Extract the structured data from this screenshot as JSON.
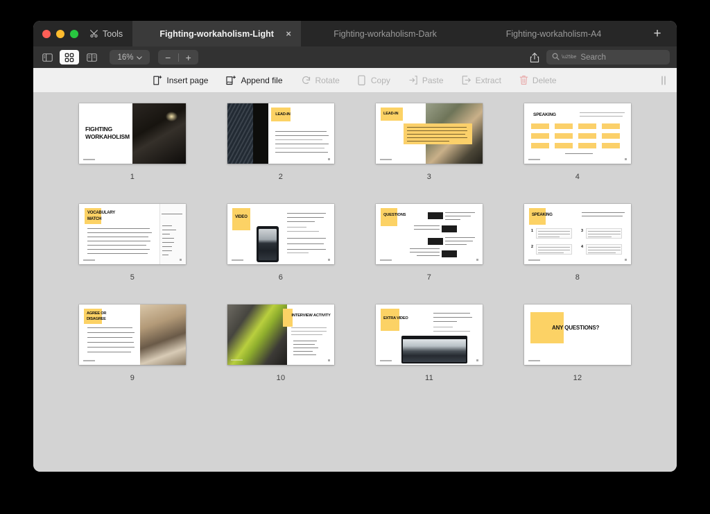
{
  "window": {
    "traffic_lights": [
      "close",
      "minimize",
      "maximize"
    ],
    "tools_label": "Tools"
  },
  "tabs": [
    {
      "label": "Fighting-workaholism-Light",
      "active": true,
      "close": "×"
    },
    {
      "label": "Fighting-workaholism-Dark",
      "active": false,
      "close": "×"
    },
    {
      "label": "Fighting-workaholism-A4",
      "active": false,
      "close": "×"
    }
  ],
  "new_tab_label": "+",
  "toolbar": {
    "sidebar_icon": "sidebar-icon",
    "grid_icon": "thumbnail-grid-icon",
    "split_icon": "split-view-icon",
    "zoom_value": "16%",
    "zoom_caret": "⌄",
    "zoom_out": "−",
    "zoom_in": "+",
    "share_icon": "share-icon",
    "search_placeholder": "Search",
    "search_value": ""
  },
  "actions": [
    {
      "label": "Insert page",
      "icon": "insert-page-icon",
      "enabled": true
    },
    {
      "label": "Append file",
      "icon": "append-file-icon",
      "enabled": true
    },
    {
      "label": "Rotate",
      "icon": "rotate-icon",
      "enabled": false
    },
    {
      "label": "Copy",
      "icon": "copy-icon",
      "enabled": false
    },
    {
      "label": "Paste",
      "icon": "paste-icon",
      "enabled": false
    },
    {
      "label": "Extract",
      "icon": "extract-icon",
      "enabled": false
    },
    {
      "label": "Delete",
      "icon": "trash-icon",
      "enabled": false
    }
  ],
  "colors": {
    "accent_yellow": "#fbd06a",
    "titlebar": "#272727",
    "toolbar": "#323232",
    "actionbar": "#f0f0f0",
    "canvas": "#d3d3d3"
  },
  "pages": [
    {
      "number": "1",
      "title": "FIGHTING WORKAHOLISM",
      "layout": "title-photo-right"
    },
    {
      "number": "2",
      "title": "LEAD-IN",
      "layout": "photo-left-list-right"
    },
    {
      "number": "3",
      "title": "LEAD-IN",
      "layout": "quote-over-photo"
    },
    {
      "number": "4",
      "title": "SPEAKING",
      "layout": "word-grid"
    },
    {
      "number": "5",
      "title": "VOCABULARY MATCH",
      "layout": "two-column-match"
    },
    {
      "number": "6",
      "title": "VIDEO",
      "layout": "phone-video"
    },
    {
      "number": "7",
      "title": "QUESTIONS",
      "layout": "zigzag-questions"
    },
    {
      "number": "8",
      "title": "SPEAKING",
      "layout": "four-quote-cards"
    },
    {
      "number": "9",
      "title": "AGREE OR DISAGREE",
      "layout": "list-photo-right"
    },
    {
      "number": "10",
      "title": "INTERVIEW ACTIVITY",
      "layout": "photo-left-text-right"
    },
    {
      "number": "11",
      "title": "EXTRA VIDEO",
      "layout": "laptop-video"
    },
    {
      "number": "12",
      "title": "ANY QUESTIONS?",
      "layout": "closing"
    }
  ],
  "slide_text": {
    "p1_heading_line1": "FIGHTING",
    "p1_heading_line2": "WORKAHOLISM",
    "p3_quote": "“If we love our work, that doesn’t mean we’re addicted to it. But if we’re a workaholic, it’s easy to convince ourselves that we work so much because we love it or because we need to when we actually don’t.”",
    "p4_instruction": "Choose the most important factor for living a meaningful, fulfilled life, and explain your choice.",
    "p4_question": "What makes a life worthwhile?",
    "p4_words": [
      "Wealth",
      "Personal growth",
      "Leisure time",
      "Family",
      "Community service",
      "Mentoring",
      "Purpose",
      "Career success",
      "Health",
      "Spirituality",
      "Adventure",
      "Work-life balance"
    ],
    "p5_instruction": "Match the words and definitions.",
    "p5_words": [
      "obtrusive",
      "overstimulation",
      "recoil",
      "addiction",
      "objectivity",
      "antidote",
      "implicit",
      "insult"
    ],
    "p6_video_title": "Fighting Workaholism: You’re More Than a Success Machine",
    "p6_duration": "Duration: 5:39 min",
    "p7_instruction": "",
    "p8_instruction": "Read the quotes. Explain each one. Identify the one that was not mentioned in the video.",
    "p10_instruction": "Pair up with a partner and take turns to take a role-play and ask other about your ideal job. Consider aspects such as:",
    "p11_video_title": "Fighting Workaholism: You Are Not a Success Machine",
    "p11_duration": "Duration: 4:18 min",
    "p12_heading": "ANY QUESTIONS?"
  }
}
